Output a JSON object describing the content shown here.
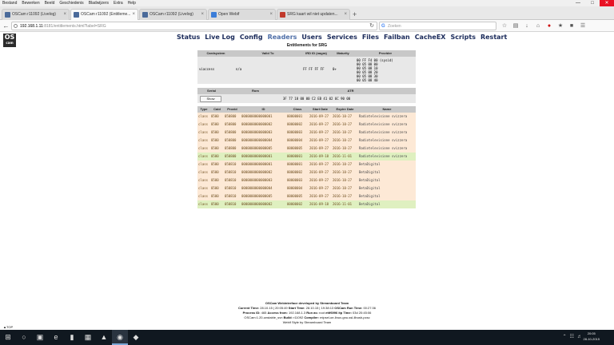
{
  "menubar": {
    "items": [
      "Bestand",
      "Bewerken",
      "Beeld",
      "Geschiedenis",
      "Bladwijzers",
      "Extra",
      "Help"
    ]
  },
  "tabs": [
    {
      "label": "OSCam r11092 (Livelog)",
      "icon": "oscam-icon",
      "active": false
    },
    {
      "label": "OSCam r11092 (Entitleme...",
      "icon": "oscam-icon",
      "active": true
    },
    {
      "label": "OSCam r11092 (Livelog)",
      "icon": "oscam-icon",
      "active": false
    },
    {
      "label": "Open Webif",
      "icon": "web-icon",
      "active": false
    },
    {
      "label": "SRG kaart wil niet updaten...",
      "icon": "srg-icon",
      "active": false
    }
  ],
  "address": {
    "host": "192.168.1.11",
    "path": ":8181/entitlements.html?label=SRG"
  },
  "search": {
    "placeholder": "Zoeken"
  },
  "oscam": {
    "logo_top": "OS",
    "logo_bottom": "cam",
    "menu": [
      "Status",
      "Live Log",
      "Config",
      "Readers",
      "Users",
      "Services",
      "Files",
      "Failban",
      "CacheEX",
      "Scripts",
      "Restart"
    ],
    "active_menu": "Readers",
    "page_title": "Entitlements for SRG"
  },
  "card_table": {
    "headers": [
      "Cardsystem",
      "Valid To",
      "IRD ID (nagra)",
      "Maturity",
      "Provider"
    ],
    "row": {
      "cardsystem": "viaccess",
      "valid_to": "n/a",
      "ird": "FF FF FF FF",
      "maturity": "0+",
      "providers": [
        "00 FF F4 00 (sysid)",
        "00 05 08 00",
        "00 05 08 10",
        "00 05 08 20",
        "00 05 08 30",
        "00 05 08 40"
      ]
    }
  },
  "serial_table": {
    "headers": [
      "Serial",
      "Rom",
      "ATR"
    ],
    "show_label": "Show",
    "atr": "3F 77 18 00 00 C2 EB 41 02 6C 90 00"
  },
  "entitlements": {
    "headers": [
      "Type",
      "Caid",
      "Provid",
      "ID",
      "Class",
      "Start Date",
      "Expire Date",
      "Name"
    ],
    "rows": [
      {
        "type": "class",
        "caid": "0500",
        "provid": "050800",
        "id": "0000000000000001",
        "class": "00000001",
        "start": "2016-09-27",
        "expire": "2016-10-27",
        "name": "Radiotelevisione svizzera",
        "status": "expired"
      },
      {
        "type": "class",
        "caid": "0500",
        "provid": "050800",
        "id": "0000000000000002",
        "class": "00000002",
        "start": "2016-09-27",
        "expire": "2016-10-27",
        "name": "Radiotelevisione svizzera",
        "status": "expired"
      },
      {
        "type": "class",
        "caid": "0500",
        "provid": "050800",
        "id": "0000000000000003",
        "class": "00000003",
        "start": "2016-09-27",
        "expire": "2016-10-27",
        "name": "Radiotelevisione svizzera",
        "status": "expired"
      },
      {
        "type": "class",
        "caid": "0500",
        "provid": "050800",
        "id": "0000000000000004",
        "class": "00000004",
        "start": "2016-09-27",
        "expire": "2016-10-27",
        "name": "Radiotelevisione svizzera",
        "status": "expired"
      },
      {
        "type": "class",
        "caid": "0500",
        "provid": "050800",
        "id": "0000000000000005",
        "class": "00000005",
        "start": "2016-09-27",
        "expire": "2016-10-27",
        "name": "Radiotelevisione svizzera",
        "status": "expired"
      },
      {
        "type": "class",
        "caid": "0500",
        "provid": "050800",
        "id": "0000000000000001",
        "class": "00000001",
        "start": "2016-09-18",
        "expire": "2016-11-01",
        "name": "Radiotelevisione svizzera",
        "status": "valid"
      },
      {
        "type": "class",
        "caid": "0500",
        "provid": "050810",
        "id": "0000000000000001",
        "class": "00000001",
        "start": "2016-09-27",
        "expire": "2016-10-27",
        "name": "BetaDigital",
        "status": "expired"
      },
      {
        "type": "class",
        "caid": "0500",
        "provid": "050810",
        "id": "0000000000000002",
        "class": "00000002",
        "start": "2016-09-27",
        "expire": "2016-10-27",
        "name": "BetaDigital",
        "status": "expired"
      },
      {
        "type": "class",
        "caid": "0500",
        "provid": "050810",
        "id": "0000000000000003",
        "class": "00000003",
        "start": "2016-09-27",
        "expire": "2016-10-27",
        "name": "BetaDigital",
        "status": "expired"
      },
      {
        "type": "class",
        "caid": "0500",
        "provid": "050810",
        "id": "0000000000000004",
        "class": "00000004",
        "start": "2016-09-27",
        "expire": "2016-10-27",
        "name": "BetaDigital",
        "status": "expired"
      },
      {
        "type": "class",
        "caid": "0500",
        "provid": "050810",
        "id": "0000000000000005",
        "class": "00000005",
        "start": "2016-09-27",
        "expire": "2016-10-27",
        "name": "BetaDigital",
        "status": "expired"
      },
      {
        "type": "class",
        "caid": "0500",
        "provid": "050810",
        "id": "0000000000000002",
        "class": "00000002",
        "start": "2016-09-18",
        "expire": "2016-11-01",
        "name": "BetaDigital",
        "status": "valid"
      }
    ]
  },
  "footer": {
    "line1": "OSCam Webinterface developed by Streamboard Team",
    "current_time_label": "Current Time:",
    "current_time": "28.10.15 | 20:05:49",
    "start_time_label": "Start Time:",
    "start_time": "28.10.15 | 19:38:13",
    "run_time_label": "OSCam Run Time:",
    "run_time": "00:27:36",
    "process_id_label": "Process ID:",
    "process_id": "465",
    "access_from_label": "Access from:",
    "access_from": "192.168.1.3",
    "run_as_label": "Run as:",
    "run_as": "root",
    "tmp_label": "ettf6996 itp Time:",
    "tmp": "03d 20:45:06",
    "version": "OSCam:1.20-unstable_svn",
    "build_label": "Build:",
    "build": "r11092",
    "compiler_label": "Compiler:",
    "compiler": "mipsel-oe-linux-gnu-ssl-libusb-pcsc",
    "style": "Webif Style by Streamboard Team",
    "totop": "▲TOP"
  },
  "taskbar": {
    "time": "20:05",
    "date": "28-10-2015"
  },
  "colors": {
    "expired_row": "#fde9d6",
    "valid_row": "#dff0c0",
    "header": "#c8c8c8"
  }
}
